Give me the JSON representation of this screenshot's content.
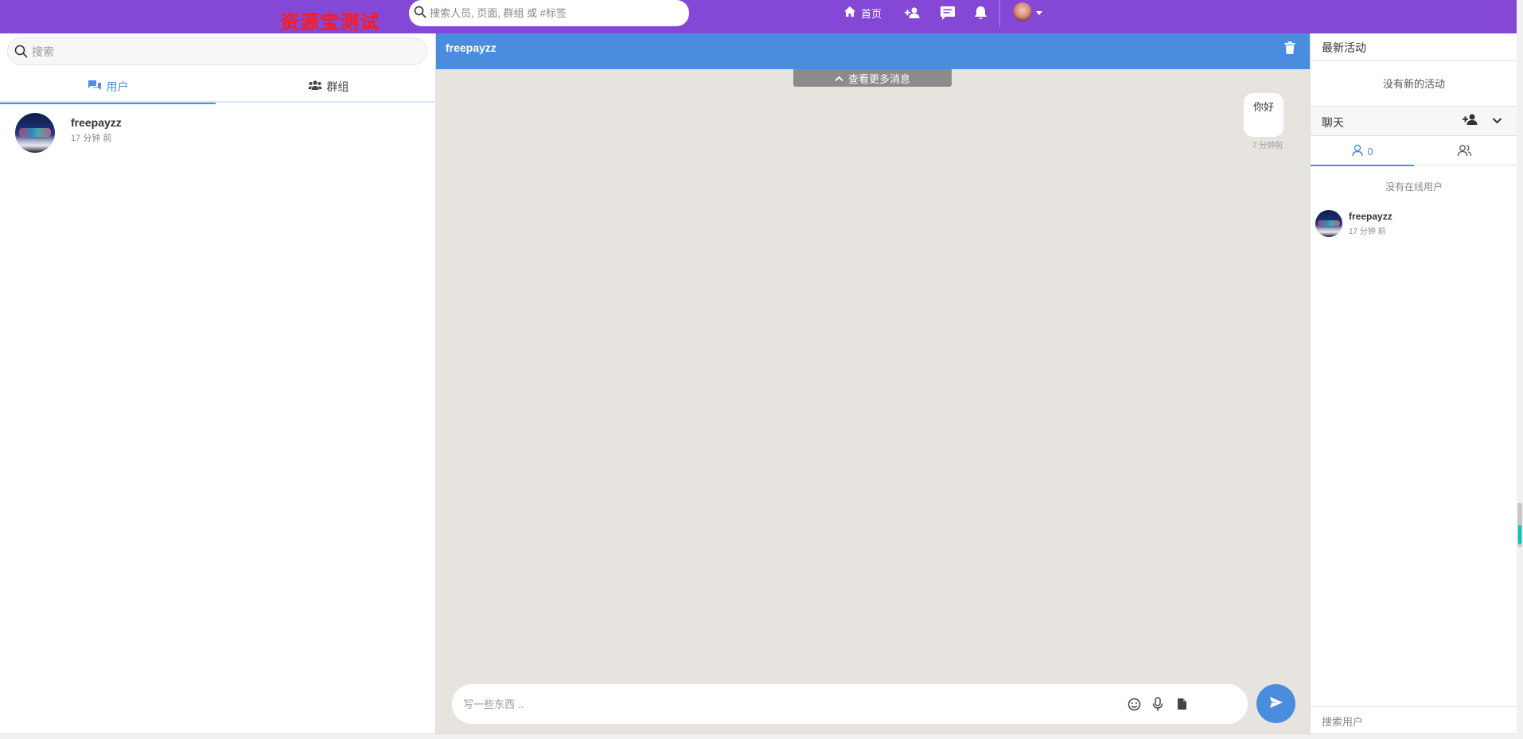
{
  "topbar": {
    "logo_text": "资源宝测试",
    "search_placeholder": "搜索人员, 页面, 群组 或 #标签",
    "home_label": "首页",
    "colors": {
      "background": "#8547d6",
      "logo": "#ff1a1a"
    },
    "icons": [
      "search-icon",
      "home-icon",
      "add-user-icon",
      "messages-icon",
      "bell-icon",
      "avatar",
      "caret-down-icon"
    ]
  },
  "left_panel": {
    "search_placeholder": "搜索",
    "tabs": [
      {
        "label": "用户",
        "icon": "chat-bubbles-icon",
        "active": true
      },
      {
        "label": "群组",
        "icon": "users-group-icon",
        "active": false
      }
    ],
    "conversations": [
      {
        "name": "freepayzz",
        "time": "17 分钟 前"
      }
    ]
  },
  "chat": {
    "title": "freepayzz",
    "load_more_label": "查看更多消息",
    "messages": [
      {
        "text": "你好",
        "time": "7 分钟前",
        "side": "right"
      }
    ],
    "composer_placeholder": "写一些东西 ..",
    "colors": {
      "header": "#4a8ddf",
      "background": "#e7e4df"
    },
    "icons": [
      "trash-icon",
      "chevron-up-icon",
      "emoji-icon",
      "microphone-icon",
      "file-icon",
      "send-icon"
    ]
  },
  "right_panel": {
    "activity_title": "最新活动",
    "activity_empty": "没有新的活动",
    "chat_label": "聊天",
    "tabs": [
      {
        "count": "0",
        "icon": "user-outline-icon",
        "active": true
      },
      {
        "count": "",
        "icon": "users-outline-icon",
        "active": false
      }
    ],
    "online_empty": "没有在线用户",
    "users": [
      {
        "name": "freepayzz",
        "time": "17 分钟 前"
      }
    ],
    "search_placeholder": "搜索用户"
  }
}
